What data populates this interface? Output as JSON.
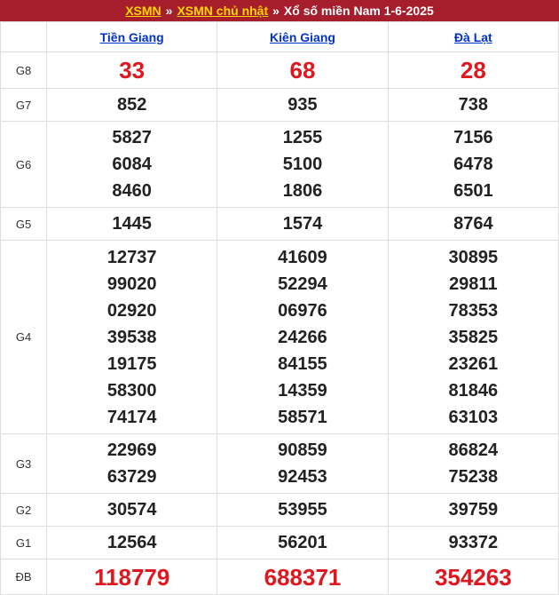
{
  "header": {
    "link1": "XSMN",
    "sep1": "»",
    "link2": "XSMN chủ nhật",
    "sep2": "»",
    "title": "Xổ số miền Nam 1-6-2025"
  },
  "provinces": [
    "Tiền Giang",
    "Kiên Giang",
    "Đà Lạt"
  ],
  "rows": {
    "g8": {
      "label": "G8",
      "values": [
        [
          "33"
        ],
        [
          "68"
        ],
        [
          "28"
        ]
      ]
    },
    "g7": {
      "label": "G7",
      "values": [
        [
          "852"
        ],
        [
          "935"
        ],
        [
          "738"
        ]
      ]
    },
    "g6": {
      "label": "G6",
      "values": [
        [
          "5827",
          "6084",
          "8460"
        ],
        [
          "1255",
          "5100",
          "1806"
        ],
        [
          "7156",
          "6478",
          "6501"
        ]
      ]
    },
    "g5": {
      "label": "G5",
      "values": [
        [
          "1445"
        ],
        [
          "1574"
        ],
        [
          "8764"
        ]
      ]
    },
    "g4": {
      "label": "G4",
      "values": [
        [
          "12737",
          "99020",
          "02920",
          "39538",
          "19175",
          "58300",
          "74174"
        ],
        [
          "41609",
          "52294",
          "06976",
          "24266",
          "84155",
          "14359",
          "58571"
        ],
        [
          "30895",
          "29811",
          "78353",
          "35825",
          "23261",
          "81846",
          "63103"
        ]
      ]
    },
    "g3": {
      "label": "G3",
      "values": [
        [
          "22969",
          "63729"
        ],
        [
          "90859",
          "92453"
        ],
        [
          "86824",
          "75238"
        ]
      ]
    },
    "g2": {
      "label": "G2",
      "values": [
        [
          "30574"
        ],
        [
          "53955"
        ],
        [
          "39759"
        ]
      ]
    },
    "g1": {
      "label": "G1",
      "values": [
        [
          "12564"
        ],
        [
          "56201"
        ],
        [
          "93372"
        ]
      ]
    },
    "db": {
      "label": "ĐB",
      "values": [
        [
          "118779"
        ],
        [
          "688371"
        ],
        [
          "354263"
        ]
      ]
    }
  },
  "colors": {
    "header_bg": "#a61d2c",
    "link_yellow": "#ffd800",
    "province_blue": "#0033cc",
    "highlight_red": "#e0171e"
  }
}
